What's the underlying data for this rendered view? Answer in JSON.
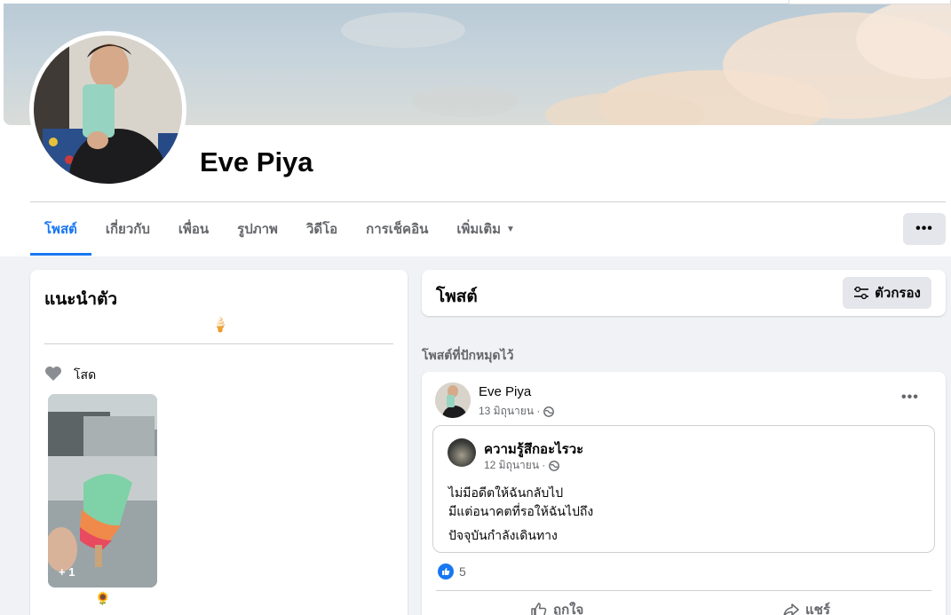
{
  "profile": {
    "name": "Eve Piya"
  },
  "tabs": [
    {
      "label": "โพสต์",
      "active": true
    },
    {
      "label": "เกี่ยวกับ"
    },
    {
      "label": "เพื่อน"
    },
    {
      "label": "รูปภาพ"
    },
    {
      "label": "วิดีโอ"
    },
    {
      "label": "การเช็คอิน"
    },
    {
      "label": "เพิ่มเติม"
    }
  ],
  "more_button": "•••",
  "intro": {
    "title": "แนะนำตัว",
    "bio_emoji": "🍦",
    "relationship": "โสด",
    "featured_count": "+ 1",
    "featured_emoji": "🌻"
  },
  "posts_header": {
    "title": "โพสต์",
    "filter_label": "ตัวกรอง"
  },
  "pinned_label": "โพสต์ที่ปักหมุดไว้",
  "post": {
    "author": "Eve Piya",
    "date": "13 มิถุนายน ·",
    "menu": "•••",
    "shared": {
      "page": "ความรู้สึกอะไรวะ",
      "date": "12 มิถุนายน ·",
      "lines": [
        "ไม่มีอดีตให้ฉันกลับไป",
        "มีแต่อนาคตที่รอให้ฉันไปถึง",
        "ปัจจุบันกำลังเดินทาง"
      ]
    },
    "reaction_count": "5",
    "like_label": "ถูกใจ",
    "share_label": "แชร์"
  },
  "colors": {
    "accent": "#1877f2",
    "muted": "#65676b",
    "background": "#f0f2f5"
  }
}
